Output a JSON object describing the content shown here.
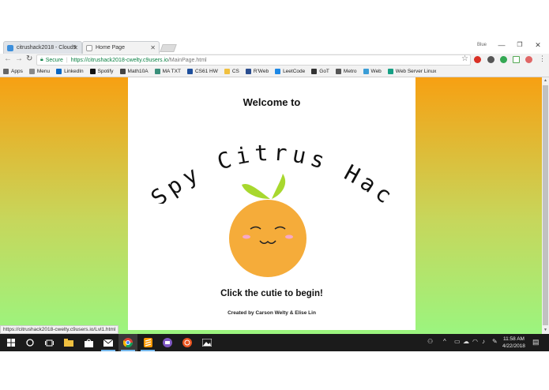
{
  "browser": {
    "tabs": [
      {
        "label": "citrushack2018 - Cloud9",
        "active": false
      },
      {
        "label": "Home Page",
        "active": true
      }
    ],
    "profile_label": "Blue",
    "security_label": "Secure",
    "url_host": "https://citrushack2018-cwelty.c9users.io",
    "url_path": "/MainPage.html",
    "bookmarks": [
      {
        "label": "Apps",
        "icon": "apps-grid-icon"
      },
      {
        "label": "Menu",
        "icon": "page-icon"
      },
      {
        "label": "LinkedIn",
        "icon": "linkedin-icon"
      },
      {
        "label": "Spotify",
        "icon": "spotify-icon"
      },
      {
        "label": "Math10A",
        "icon": "math-icon"
      },
      {
        "label": "MA TXT",
        "icon": "s-icon"
      },
      {
        "label": "CS61 HW",
        "icon": "cs-icon"
      },
      {
        "label": "CS",
        "icon": "folder-icon"
      },
      {
        "label": "R'Web",
        "icon": "r-icon"
      },
      {
        "label": "LeetCode",
        "icon": "leetcode-icon"
      },
      {
        "label": "GoT",
        "icon": "got-icon"
      },
      {
        "label": "Metro",
        "icon": "metro-icon"
      },
      {
        "label": "Web",
        "icon": "web-icon"
      },
      {
        "label": "Web Server Linux",
        "icon": "server-icon"
      }
    ],
    "status_url": "https://citrushack2018-cwelty.c9users.io/Lvl1.html"
  },
  "page": {
    "welcome": "Welcome to",
    "title": "iSpy Citrus Hack",
    "click_prompt": "Click the cutie to begin!",
    "credits": "Created by Carson Welty & Elise Lin"
  },
  "taskbar": {
    "time": "11:58 AM",
    "date": "4/22/2018"
  },
  "colors": {
    "gradient_top": "#f7a012",
    "gradient_bottom": "#9bf57f",
    "orange": "#f5ac3a",
    "leaf": "#a8d82e",
    "blush": "#f7a8c8"
  }
}
